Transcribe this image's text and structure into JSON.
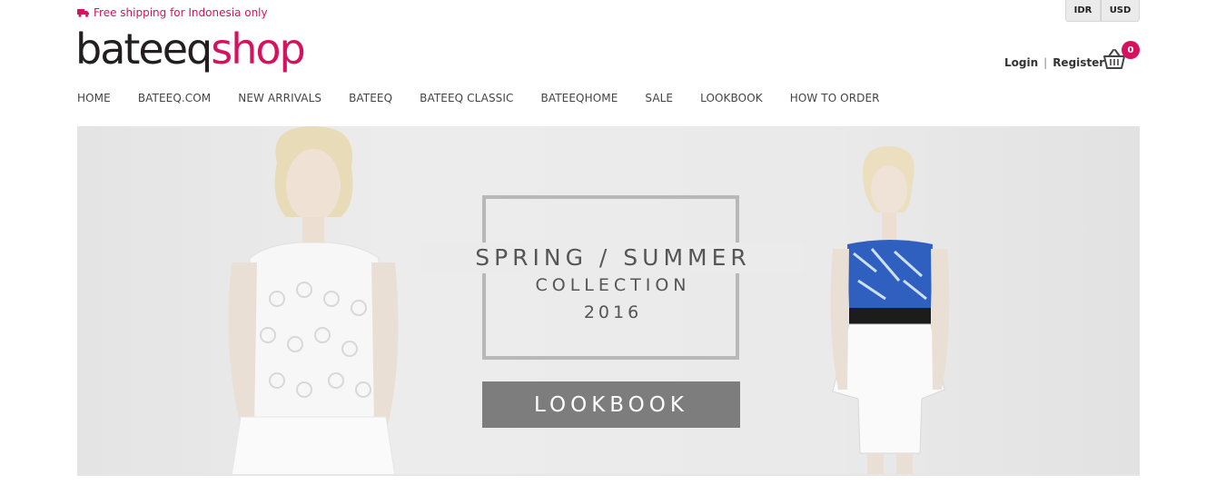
{
  "topbar": {
    "shipping_text": "Free shipping for Indonesia only",
    "icon": "truck-icon"
  },
  "currency": {
    "options": [
      "IDR",
      "USD"
    ]
  },
  "logo": {
    "part1": "bateeq",
    "part2": "shop"
  },
  "account": {
    "login": "Login",
    "separator": "|",
    "register": "Register"
  },
  "cart": {
    "count": "0",
    "icon": "basket-icon"
  },
  "nav": {
    "items": [
      "HOME",
      "BATEEQ.COM",
      "NEW ARRIVALS",
      "BATEEQ",
      "BATEEQ CLASSIC",
      "BATEEQHOME",
      "SALE",
      "LOOKBOOK",
      "HOW TO ORDER"
    ]
  },
  "hero": {
    "line1": "SPRING / SUMMER",
    "line2": "COLLECTION",
    "line3": "2016",
    "button": "LOOKBOOK"
  },
  "colors": {
    "brand": "#d6115e",
    "text": "#333333",
    "button": "#7d7d7d"
  }
}
